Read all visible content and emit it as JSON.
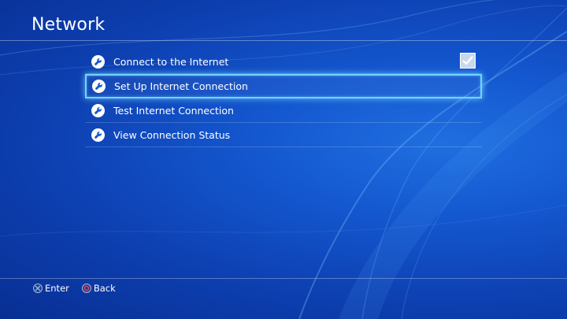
{
  "header": {
    "title": "Network"
  },
  "menu": {
    "items": [
      {
        "label": "Connect to the Internet",
        "icon": "wrench-icon",
        "checked": true
      },
      {
        "label": "Set Up Internet Connection",
        "icon": "wrench-icon",
        "selected": true
      },
      {
        "label": "Test Internet Connection",
        "icon": "wrench-icon"
      },
      {
        "label": "View Connection Status",
        "icon": "wrench-icon"
      }
    ]
  },
  "footer": {
    "enter_label": "Enter",
    "enter_icon": "cross-button-icon",
    "back_label": "Back",
    "back_icon": "circle-button-icon"
  },
  "colors": {
    "background": "#1457cf",
    "highlight": "#6fd4ff",
    "cross_button": "#6f9fe0",
    "circle_button": "#e0426a"
  }
}
